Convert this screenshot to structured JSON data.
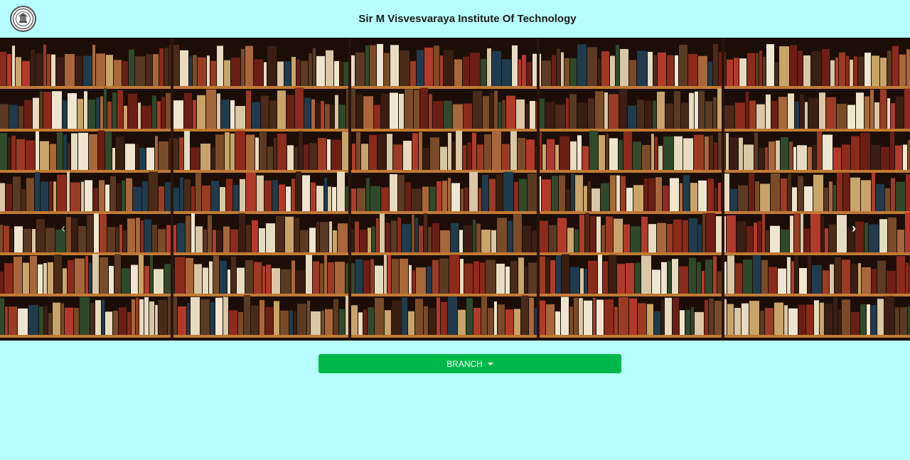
{
  "header": {
    "title": "Sir M Visvesvaraya Institute Of Technology",
    "logo_icon": "college-seal-icon"
  },
  "carousel": {
    "image": "bookshelf-library-photo",
    "prev_icon": "chevron-left-icon",
    "next_icon": "chevron-right-icon",
    "prev_glyph": "‹",
    "next_glyph": "›"
  },
  "branch_dropdown": {
    "label": "BRANCH",
    "icon": "caret-down-icon"
  },
  "colors": {
    "page_background": "#b6fffd",
    "button_green": "#00b84a",
    "shelf_wood": "#d08a3c"
  }
}
